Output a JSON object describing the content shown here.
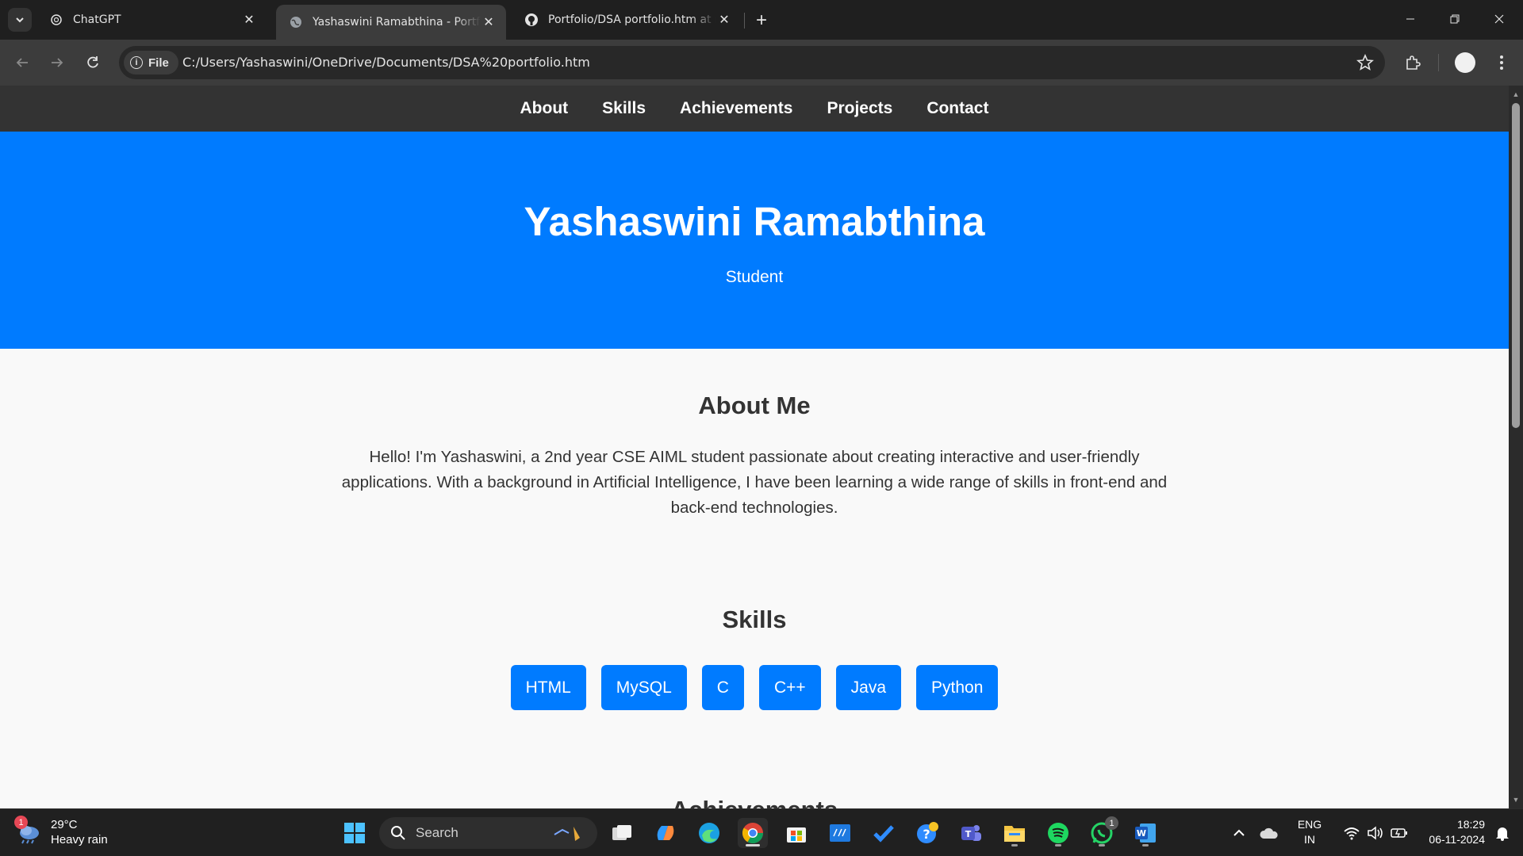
{
  "browser": {
    "tabs": [
      {
        "title": "ChatGPT",
        "icon": "chatgpt-icon",
        "active": false
      },
      {
        "title": "Yashaswini Ramabthina - Portfolio",
        "icon": "globe-icon",
        "active": true
      },
      {
        "title": "Portfolio/DSA portfolio.htm at main",
        "icon": "github-icon",
        "active": false
      }
    ],
    "address": {
      "chip_label": "File",
      "url": "C:/Users/Yashaswini/OneDrive/Documents/DSA%20portfolio.htm"
    }
  },
  "page": {
    "nav": [
      "About",
      "Skills",
      "Achievements",
      "Projects",
      "Contact"
    ],
    "hero": {
      "name": "Yashaswini Ramabthina",
      "subtitle": "Student"
    },
    "about": {
      "heading": "About Me",
      "text": "Hello! I'm Yashaswini, a 2nd year CSE AIML student passionate about creating interactive and user-friendly applications. With a background in Artificial Intelligence, I have been learning a wide range of skills in front-end and back-end technologies."
    },
    "skills": {
      "heading": "Skills",
      "items": [
        "HTML",
        "MySQL",
        "C",
        "C++",
        "Java",
        "Python"
      ]
    },
    "next_section_heading": "Achievements",
    "colors": {
      "primary": "#007bff",
      "nav_bg": "#333333",
      "page_bg": "#f9f9f9"
    }
  },
  "taskbar": {
    "weather": {
      "temp": "29°C",
      "condition": "Heavy rain",
      "badge": "1"
    },
    "search_placeholder": "Search",
    "whatsapp_badge": "1",
    "language": {
      "line1": "ENG",
      "line2": "IN"
    },
    "clock": {
      "time": "18:29",
      "date": "06-11-2024"
    }
  }
}
